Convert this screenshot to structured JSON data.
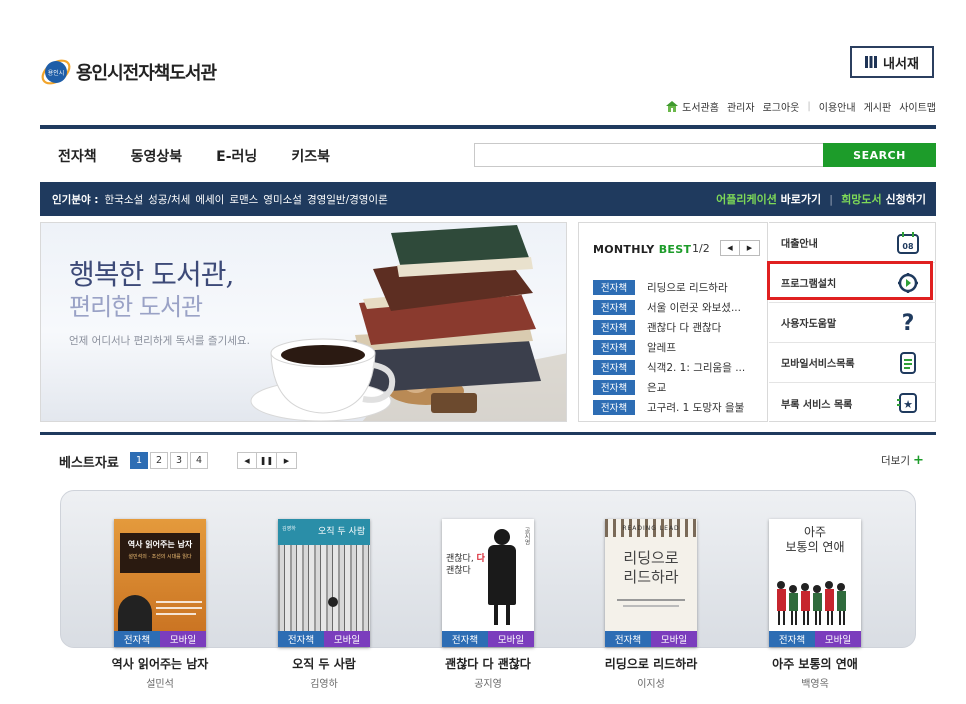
{
  "header": {
    "site_title": "용인시전자책도서관",
    "logo_mark_text": "용인시",
    "my_library_label": "내서재",
    "top_links": [
      "도서관홈",
      "관리자",
      "로그아웃",
      "이용안내",
      "게시판",
      "사이트맵"
    ]
  },
  "nav": {
    "items": [
      "전자책",
      "동영상북",
      "E-러닝",
      "키즈북"
    ],
    "search_placeholder": "",
    "search_label": "SEARCH"
  },
  "popular": {
    "label": "인기분야 :",
    "items": [
      "한국소설",
      "성공/처세",
      "에세이",
      "로맨스",
      "영미소설",
      "경영일반/경영이론"
    ],
    "app_link_green": "어플리케이션",
    "app_link_white": "바로가기",
    "wish_link_green": "희망도서",
    "wish_link_white": "신청하기"
  },
  "banner": {
    "title_line1": "행복한 도서관,",
    "title_line2": "편리한 도서관",
    "subtitle": "언제 어디서나 편리하게 독서를 즐기세요."
  },
  "monthly_best": {
    "title_black": "MONTHLY",
    "title_green": "BEST",
    "page_indicator": "1/2",
    "badge": "전자책",
    "items": [
      "리딩으로 리드하라",
      "서울 이런곳 와보셨...",
      "괜찮다 다 괜찮다",
      "알레프",
      "식객2. 1: 그리움을 ...",
      "은교",
      "고구려. 1 도망자 을불"
    ]
  },
  "quick_menu": {
    "items": [
      {
        "label": "대출안내",
        "icon": "calendar-icon",
        "icon_text": "08"
      },
      {
        "label": "프로그램설치",
        "icon": "install-icon"
      },
      {
        "label": "사용자도움말",
        "icon": "question-icon",
        "icon_text": "?"
      },
      {
        "label": "모바일서비스목록",
        "icon": "mobile-icon"
      },
      {
        "label": "부록 서비스 목록",
        "icon": "star-device-icon",
        "icon_text": "★"
      }
    ],
    "highlight_color": "#e02020"
  },
  "best_section": {
    "title": "베스트자료",
    "pages": [
      "1",
      "2",
      "3",
      "4"
    ],
    "active_page": "1",
    "more_label": "더보기",
    "badge_ebook": "전자책",
    "badge_mobile": "모바일",
    "books": [
      {
        "title": "역사 읽어주는 남자",
        "author": "설민석",
        "cover_title": "역사 읽어주는 남자",
        "cover_subtitle": "설민석의 · 조선의 시대를 읽다"
      },
      {
        "title": "오직 두 사람",
        "author": "김영하",
        "cover_title": "오직 두 사람",
        "cover_author": "김영하"
      },
      {
        "title": "괜찮다 다 괜찮다",
        "author": "공지영",
        "cover_title_line1": "괜찮다,",
        "cover_title_accent": "다",
        "cover_title_line2": "괜찮다",
        "cover_author": "공지영"
      },
      {
        "title": "리딩으로 리드하라",
        "author": "이지성",
        "cover_top": "READING LEAD",
        "cover_title_line1": "리딩으로",
        "cover_title_line2": "리드하라"
      },
      {
        "title": "아주 보통의 연애",
        "author": "백영옥",
        "cover_title_line1": "아주",
        "cover_title_line2": "보통의 연애"
      }
    ]
  },
  "colors": {
    "navy": "#1f3a5e",
    "green": "#1d9c2a",
    "badge_blue": "#2d6db4",
    "badge_purple": "#7b3dbd"
  }
}
